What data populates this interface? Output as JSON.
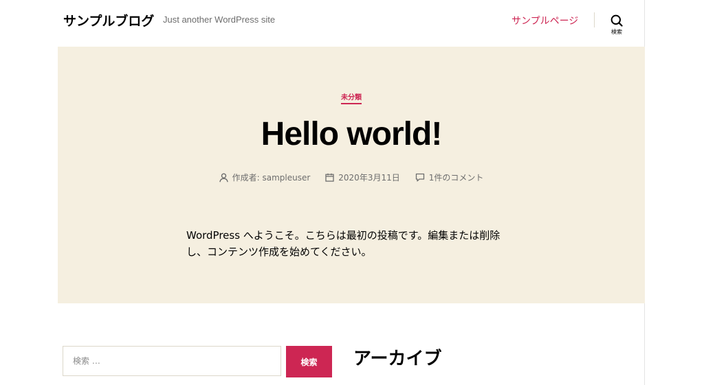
{
  "header": {
    "site_title": "サンプルブログ",
    "site_description": "Just another WordPress site",
    "nav_link": "サンプルページ",
    "search_toggle_label": "検索"
  },
  "post": {
    "category": "未分類",
    "title": "Hello world!",
    "meta": {
      "author": "作成者: sampleuser",
      "date": "2020年3月11日",
      "comments": "1件のコメント"
    },
    "body": "WordPress へようこそ。こちらは最初の投稿です。編集または削除し、コンテンツ作成を始めてください。"
  },
  "widgets": {
    "search_placeholder": "検索 …",
    "search_button": "検索",
    "archive_title": "アーカイブ"
  },
  "colors": {
    "accent": "#cd2653",
    "hero_background": "#f5efe0",
    "meta_text": "#6d6d6d"
  },
  "icons": {
    "search_toggle": "search-icon",
    "author": "user-icon",
    "date": "calendar-icon",
    "comments": "comment-icon"
  }
}
